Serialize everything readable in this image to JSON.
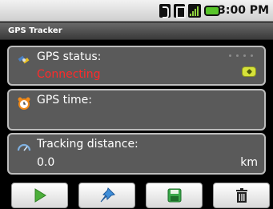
{
  "status_bar": {
    "time": "3:00 PM",
    "icons": [
      "bluetooth-icon",
      "vibrate-icon",
      "signal-icon",
      "battery-icon"
    ],
    "battery_color": "#58c52a"
  },
  "app": {
    "title": "GPS Tracker"
  },
  "panels": {
    "gps_status": {
      "label": "GPS status:",
      "value": "Connecting",
      "value_color": "#ff2a2a",
      "icon": "satellite-icon"
    },
    "gps_time": {
      "label": "GPS time:",
      "icon": "alarm-clock-icon"
    },
    "tracking_distance": {
      "label": "Tracking distance:",
      "value": "0.0",
      "unit": "km",
      "icon": "odometer-icon"
    }
  },
  "toolbar": {
    "buttons": [
      {
        "name": "play-button",
        "icon": "play-icon",
        "color": "#4caf3a"
      },
      {
        "name": "pin-button",
        "icon": "pushpin-icon",
        "color": "#3f8ed8"
      },
      {
        "name": "save-button",
        "icon": "floppy-disk-icon",
        "color": "#3aa84a"
      },
      {
        "name": "delete-button",
        "icon": "trash-icon",
        "color": "#222222"
      }
    ]
  }
}
